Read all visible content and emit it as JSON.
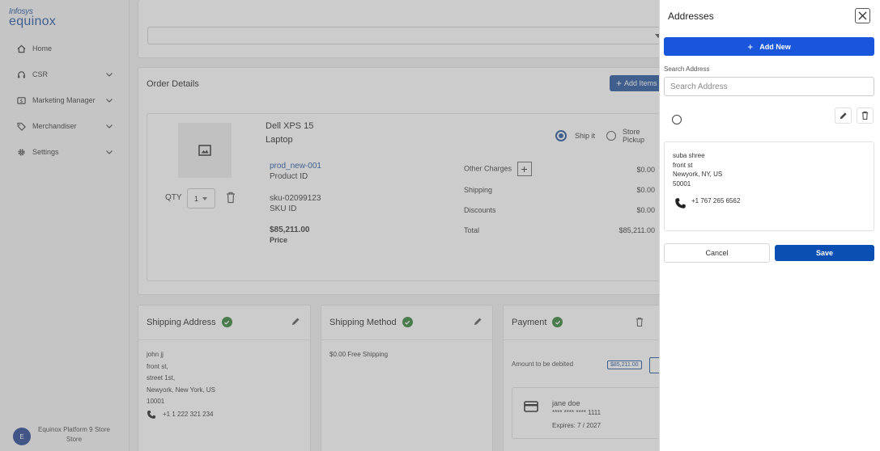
{
  "sidebar": {
    "brand_top": "Infosys",
    "brand_main": "equinox",
    "items": [
      {
        "label": "Home",
        "icon": "home-icon"
      },
      {
        "label": "CSR",
        "icon": "headset-icon"
      },
      {
        "label": "Marketing Manager",
        "icon": "dollar-icon"
      },
      {
        "label": "Merchandiser",
        "icon": "tag-icon"
      },
      {
        "label": "Settings",
        "icon": "gear-icon"
      }
    ],
    "store": {
      "avatar": "E",
      "line1": "Equinox Platform 9 Store",
      "line2": "Store"
    }
  },
  "order": {
    "title": "Order Details",
    "add_items_label": "Add Items",
    "item": {
      "name_line1": "Dell XPS 15",
      "name_line2": "Laptop",
      "qty_label": "QTY",
      "qty_value": "1",
      "product_id": "prod_new-001",
      "product_id_label": "Product ID",
      "sku": "sku-02099123",
      "sku_label": "SKU ID",
      "price": "$85,211.00",
      "price_label": "Price",
      "ship_it": "Ship it",
      "store_pickup": "Store Pickup",
      "charges": [
        {
          "label": "Other Charges",
          "value": "$0.00"
        },
        {
          "label": "Shipping",
          "value": "$0.00"
        },
        {
          "label": "Discounts",
          "value": "$0.00"
        },
        {
          "label": "Total",
          "value": "$85,211.00"
        }
      ]
    }
  },
  "shipping_address": {
    "title": "Shipping Address",
    "lines": [
      "john jj",
      "front st,",
      "street 1st,",
      "Newyork, New York, US",
      "10001"
    ],
    "phone": "+1 1 222 321 234"
  },
  "shipping_method": {
    "title": "Shipping Method",
    "value": "$0.00 Free Shipping"
  },
  "payment": {
    "title": "Payment",
    "debit_label": "Amount to be debited",
    "debit_amount": "$85,211.00",
    "card_name": "jane doe",
    "card_number": "**** **** **** 1111",
    "card_expiry": "Expires: 7 / 2027"
  },
  "drawer": {
    "title": "Addresses",
    "add_new_label": "Add New",
    "search_label": "Search Address",
    "search_placeholder": "Search Address",
    "address": {
      "lines": [
        "suba shree",
        "front st",
        "Newyork, NY, US",
        "50001"
      ],
      "phone": "+1 767 265 6562"
    },
    "cancel_label": "Cancel",
    "save_label": "Save"
  },
  "colors": {
    "brand": "#1f4f9a",
    "primary_button": "#1a56db",
    "success": "#2e7d32"
  }
}
